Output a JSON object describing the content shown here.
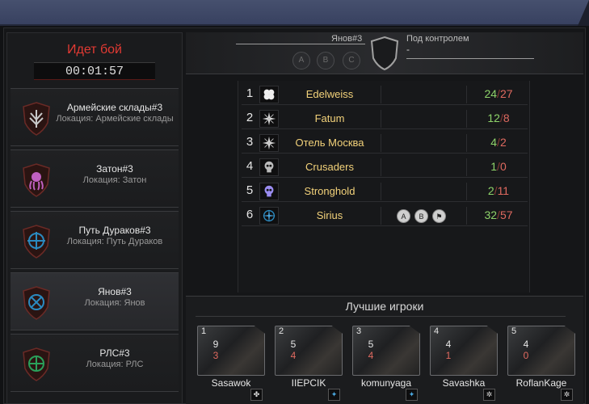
{
  "battle": {
    "status": "Идет бой",
    "timer": "00:01:57"
  },
  "locations": [
    {
      "name": "Армейские склады#3",
      "sub": "Локация: Армейские склады"
    },
    {
      "name": "Затон#3",
      "sub": "Локация: Затон"
    },
    {
      "name": "Путь Дураков#3",
      "sub": "Локация: Путь Дураков"
    },
    {
      "name": "Янов#3",
      "sub": "Локация: Янов"
    },
    {
      "name": "РЛС#3",
      "sub": "Локация: РЛС"
    }
  ],
  "zone": {
    "name": "Янов#3",
    "points": [
      "A",
      "B",
      "C"
    ],
    "control_label": "Под контролем",
    "control_value": "-"
  },
  "clans": [
    {
      "rank": "1",
      "name": "Edelweiss",
      "wins": "24",
      "losses": "27",
      "icon": "clover-icon"
    },
    {
      "rank": "2",
      "name": "Fatum",
      "wins": "12",
      "losses": "8",
      "icon": "star-cross-icon"
    },
    {
      "rank": "3",
      "name": "Отель Москва",
      "wins": "4",
      "losses": "2",
      "icon": "star-cross-icon"
    },
    {
      "rank": "4",
      "name": "Crusaders",
      "wins": "1",
      "losses": "0",
      "icon": "skull-icon"
    },
    {
      "rank": "5",
      "name": "Stronghold",
      "wins": "2",
      "losses": "11",
      "icon": "skull-icon"
    },
    {
      "rank": "6",
      "name": "Sirius",
      "wins": "32",
      "losses": "57",
      "icon": "compass-icon",
      "points": [
        "A",
        "B"
      ],
      "flag": "⚑"
    }
  ],
  "best_players": {
    "title": "Лучшие игроки",
    "players": [
      {
        "pos": "1",
        "kills": "9",
        "deaths": "3",
        "name": "Sasawok"
      },
      {
        "pos": "2",
        "kills": "5",
        "deaths": "4",
        "name": "IIEPCIK"
      },
      {
        "pos": "3",
        "kills": "5",
        "deaths": "4",
        "name": "komunyaga"
      },
      {
        "pos": "4",
        "kills": "4",
        "deaths": "1",
        "name": "Savashka"
      },
      {
        "pos": "5",
        "kills": "4",
        "deaths": "0",
        "name": "RoflanKage"
      }
    ]
  },
  "colors": {
    "accent_red": "#e23a33",
    "clan_gold": "#f3d27a",
    "win_green": "#8ed36a",
    "loss_red": "#e06a60"
  }
}
